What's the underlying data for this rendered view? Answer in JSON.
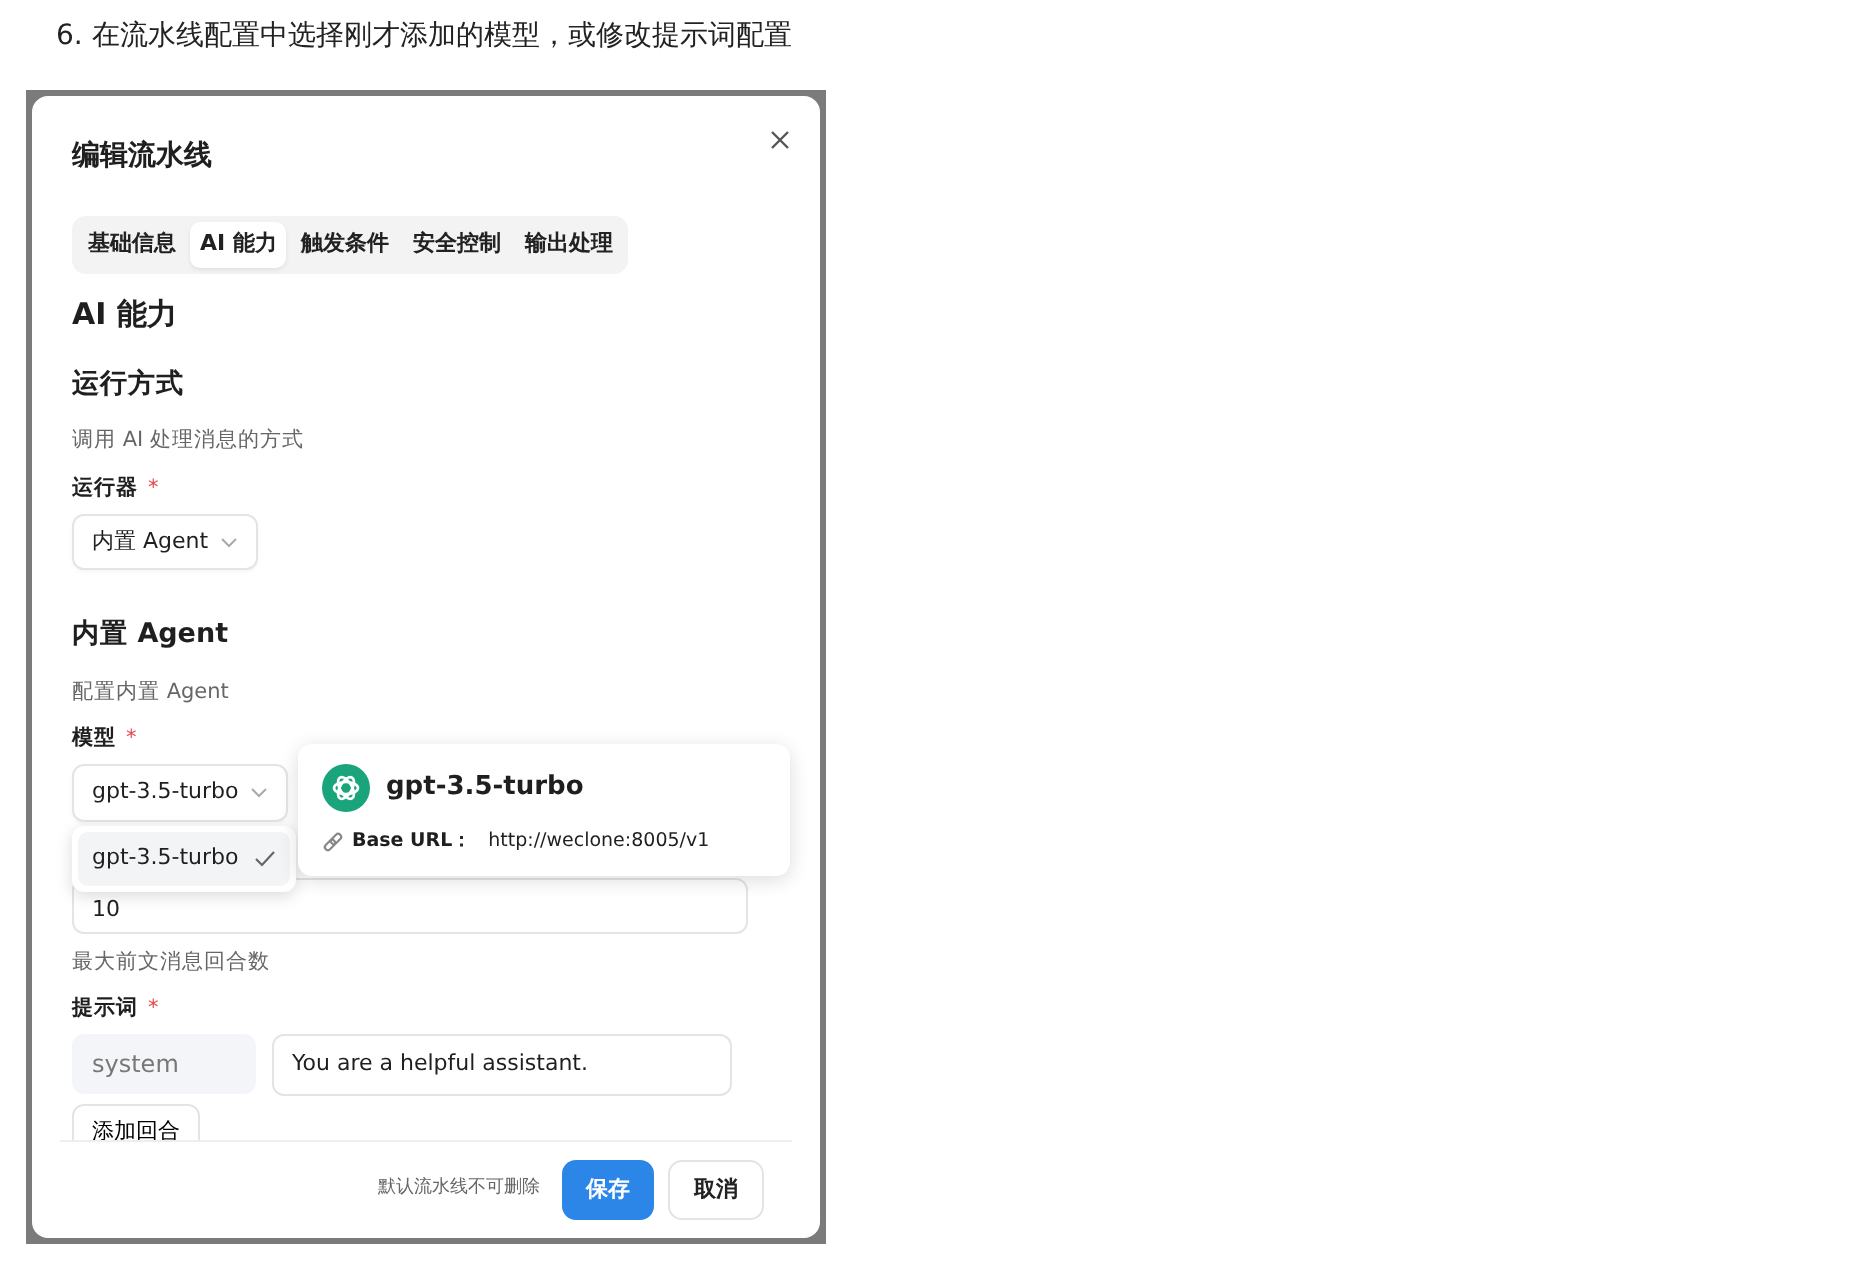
{
  "caption": "6. 在流水线配置中选择刚才添加的模型，或修改提示词配置",
  "dialog": {
    "title": "编辑流水线",
    "tabs": [
      {
        "label": "基础信息",
        "selected": false
      },
      {
        "label": "AI 能力",
        "selected": true
      },
      {
        "label": "触发条件",
        "selected": false
      },
      {
        "label": "安全控制",
        "selected": false
      },
      {
        "label": "输出处理",
        "selected": false
      }
    ],
    "section_title": "AI 能力",
    "runner_group": {
      "title": "运行方式",
      "description": "调用 AI 处理消息的方式",
      "label": "运行器",
      "required": "*",
      "value": "内置 Agent"
    },
    "agent_group": {
      "title": "内置 Agent",
      "description": "配置内置 Agent",
      "model_label": "模型",
      "model_required": "*",
      "model_value": "gpt-3.5-turbo",
      "model_options": [
        {
          "label": "gpt-3.5-turbo",
          "selected": true
        }
      ],
      "model_card": {
        "name": "gpt-3.5-turbo",
        "base_url_label": "Base URL：",
        "base_url": "http://weclone:8005/v1"
      },
      "rounds_value": "10",
      "rounds_description": "最大前文消息回合数",
      "prompt_label": "提示词",
      "prompt_required": "*",
      "prompts": [
        {
          "role": "system",
          "content": "You are a helpful assistant."
        }
      ],
      "add_button": "添加回合"
    },
    "footer": {
      "note": "默认流水线不可删除",
      "buttons": [
        {
          "label": "保存",
          "kind": "primary"
        },
        {
          "label": "取消",
          "kind": "secondary"
        }
      ]
    }
  }
}
